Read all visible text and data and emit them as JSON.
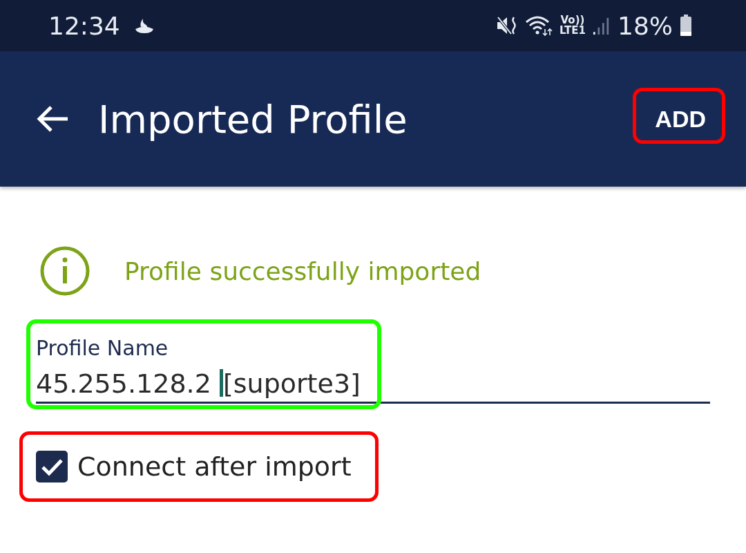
{
  "status_bar": {
    "time": "12:34",
    "network_label_top": "Vo))",
    "network_label_bottom": "LTE1",
    "battery": "18%"
  },
  "app_bar": {
    "title": "Imported Profile",
    "action": {
      "label": "ADD",
      "highlight": {
        "color": "#ff0000"
      }
    }
  },
  "message": {
    "text": "Profile successfully imported",
    "color": "#7da317"
  },
  "profile_name": {
    "label": "Profile Name",
    "value_before_cursor": "45.255.128.2",
    "value_after_cursor": "[suporte3]",
    "highlight": {
      "color": "#1eff00"
    }
  },
  "connect_after_import": {
    "label": "Connect after import",
    "checked": true,
    "highlight": {
      "color": "#ff0000"
    }
  }
}
